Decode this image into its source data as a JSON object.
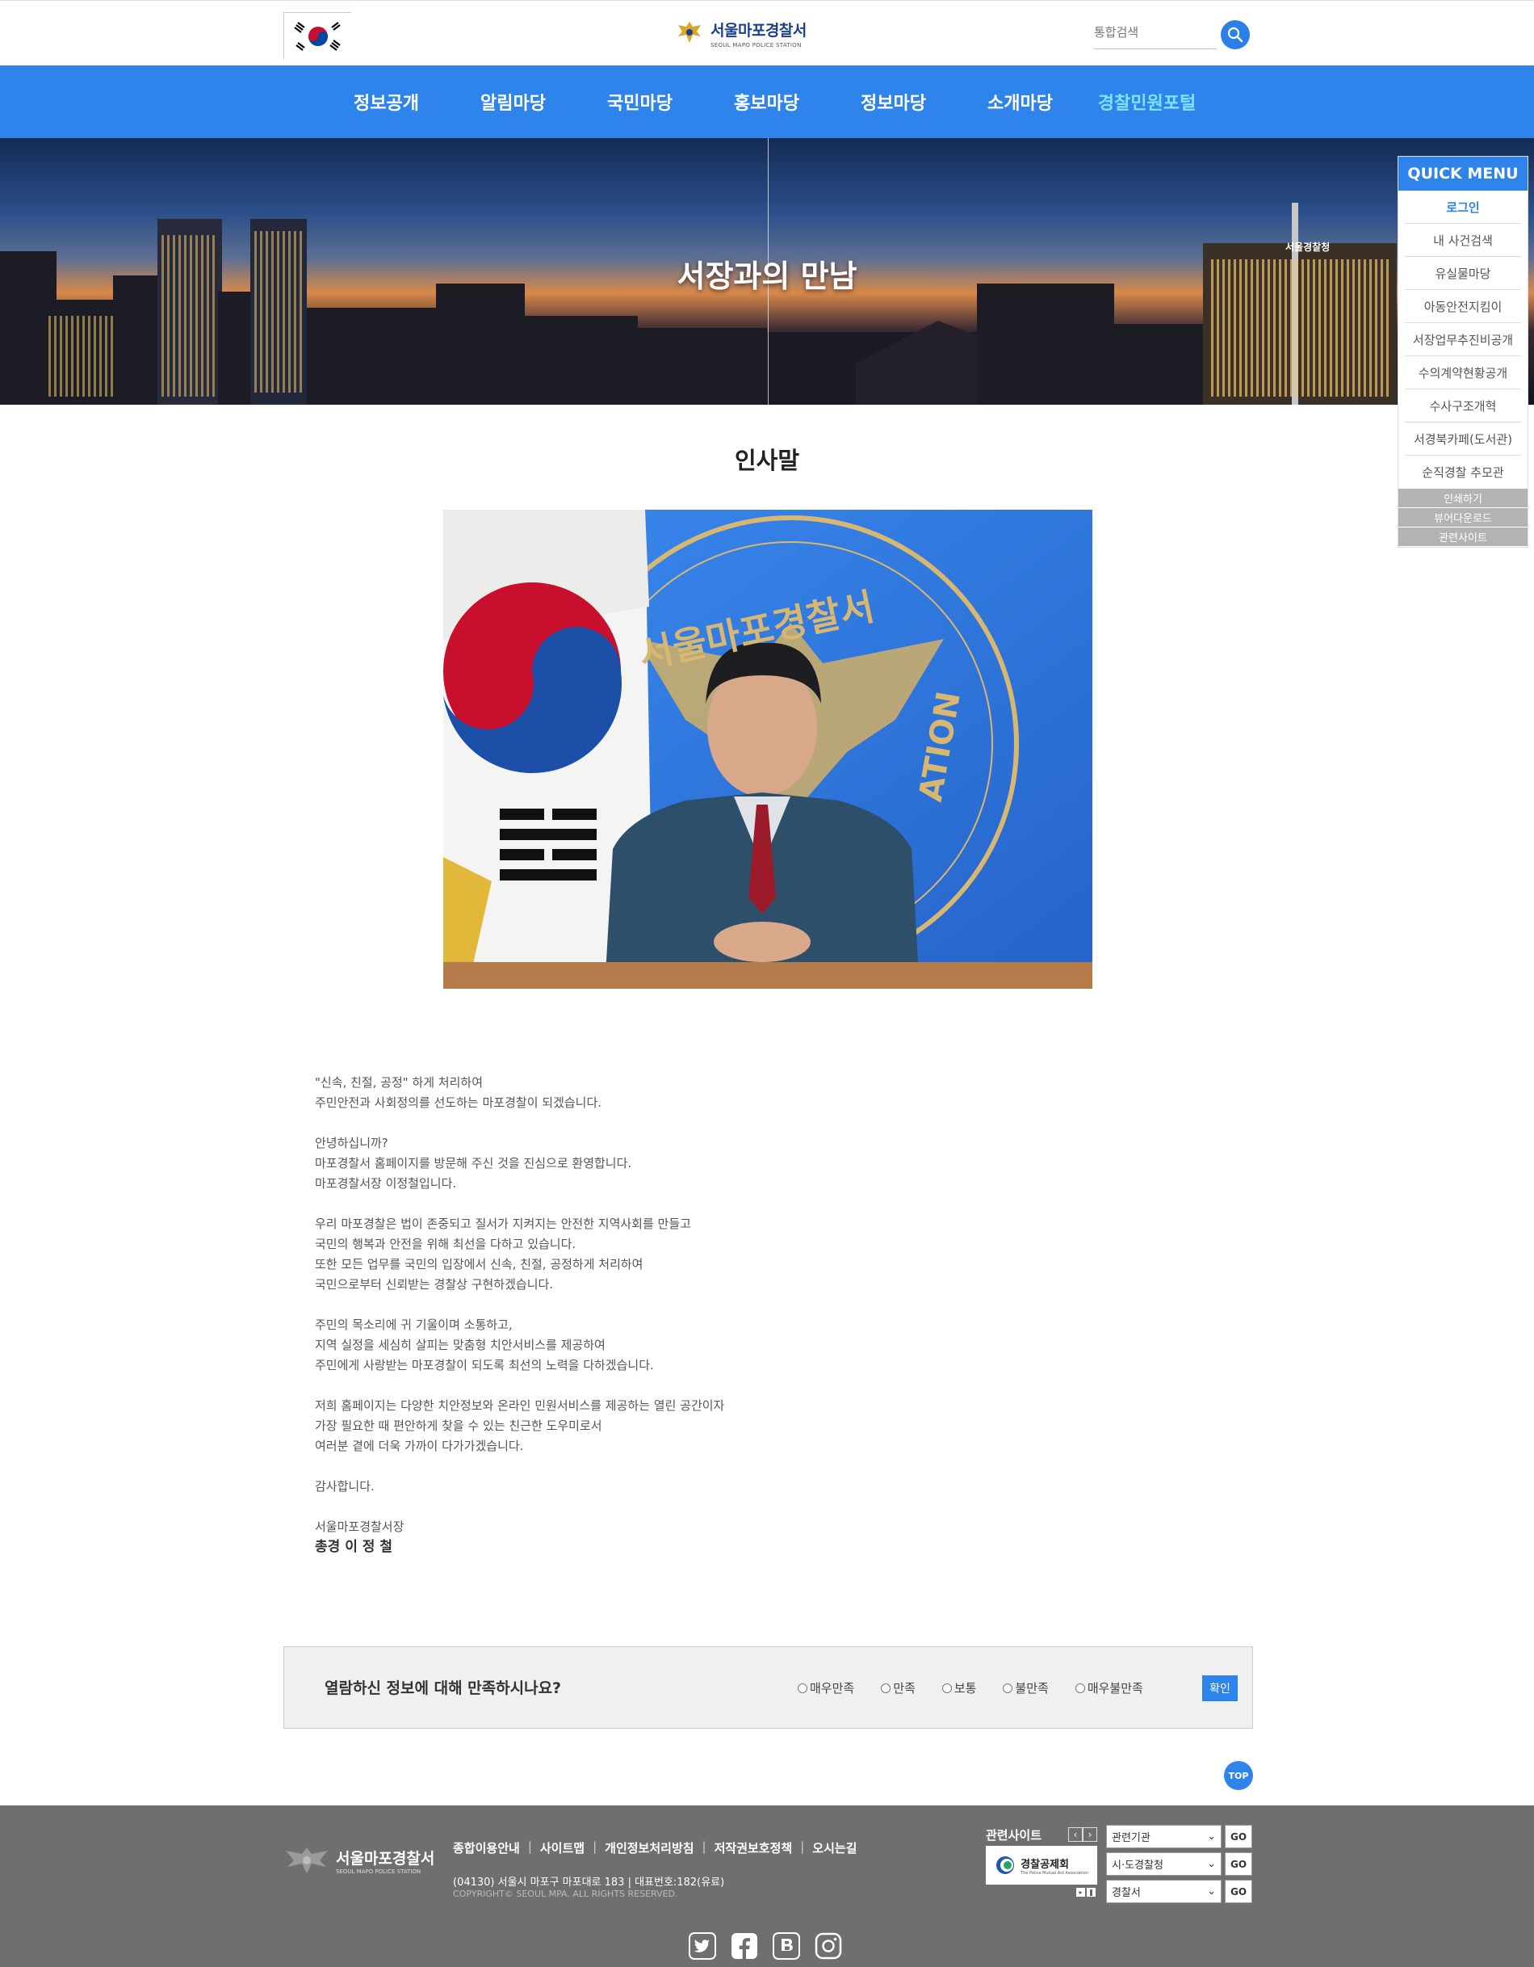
{
  "header": {
    "logo_ko": "서울마포경찰서",
    "logo_en": "SEOUL MAPO POLICE STATION",
    "search_placeholder": "통합검색"
  },
  "nav": {
    "items": [
      "정보공개",
      "알림마당",
      "국민마당",
      "홍보마당",
      "정보마당",
      "소개마당",
      "경찰민원포털"
    ]
  },
  "banner": {
    "title": "서장과의 만남",
    "sign": "서울경찰청"
  },
  "quick_menu": {
    "title": "QUICK MENU",
    "items": [
      "로그인",
      "내 사건검색",
      "유실물마당",
      "아동안전지킴이",
      "서장업무추진비공개",
      "수의계약현황공개",
      "수사구조개혁",
      "서경북카페(도서관)",
      "순직경찰 추모관"
    ],
    "gray_items": [
      "인쇄하기",
      "뷰어다운로드",
      "관련사이트"
    ]
  },
  "content": {
    "page_title": "인사말",
    "photo_emblem_text": "서울마포경찰서",
    "photo_emblem_text2": "ATION",
    "paragraphs": [
      [
        "\"신속, 친절, 공정\" 하게 처리하여",
        "주민안전과 사회정의를 선도하는 마포경찰이 되겠습니다."
      ],
      [
        "안녕하십니까?",
        "마포경찰서 홈페이지를 방문해 주신 것을 진심으로 환영합니다.",
        "마포경찰서장 이정철입니다."
      ],
      [
        "우리 마포경찰은 법이 존중되고 질서가 지켜지는 안전한 지역사회를 만들고",
        "국민의 행복과 안전을 위해 최선을 다하고 있습니다.",
        "또한 모든 업무를 국민의 입장에서 신속, 친절, 공정하게 처리하여",
        "국민으로부터 신뢰받는 경찰상 구현하겠습니다."
      ],
      [
        "주민의 목소리에 귀 기울이며 소통하고,",
        "지역 실정을 세심히 살피는 맞춤형 치안서비스를 제공하여",
        "주민에게 사랑받는 마포경찰이 되도록 최선의 노력을 다하겠습니다."
      ],
      [
        "저희 홈페이지는 다양한 치안정보와 온라인 민원서비스를 제공하는 열린 공간이자",
        "가장 필요한 때 편안하게 찾을 수 있는 친근한 도우미로서",
        "여러분 곁에 더욱 가까이 다가가겠습니다."
      ],
      [
        "감사합니다."
      ]
    ],
    "signature_title": "서울마포경찰서장",
    "signature_name": "총경 이 정 철"
  },
  "survey": {
    "question": "열람하신 정보에 대해 만족하시나요?",
    "options": [
      "매우만족",
      "만족",
      "보통",
      "불만족",
      "매우불만족"
    ],
    "submit_label": "확인"
  },
  "top_label": "TOP",
  "footer": {
    "logo_ko": "서울마포경찰서",
    "logo_en": "SEOUL MAPO POLICE STATION",
    "links": [
      "종합이용안내",
      "사이트맵",
      "개인정보처리방침",
      "저작권보호정책",
      "오시는길"
    ],
    "address": "(04130) 서울시 마포구 마포대로 183   |   대표번호:182(유료)",
    "copyright": "COPYRIGHT© SEOUL MPA. ALL RIGHTS RESERVED.",
    "related_label": "관련사이트",
    "related_banner": "경찰공제회",
    "related_banner_sub": "The Police Mutual Aid Association",
    "selects": [
      "관련기관",
      "시·도경찰청",
      "경찰서"
    ],
    "go_label": "GO"
  },
  "colors": {
    "primary_blue": "#2e84ea",
    "nav_active": "#7fe3ff",
    "footer_bg": "#6f6f6f"
  }
}
